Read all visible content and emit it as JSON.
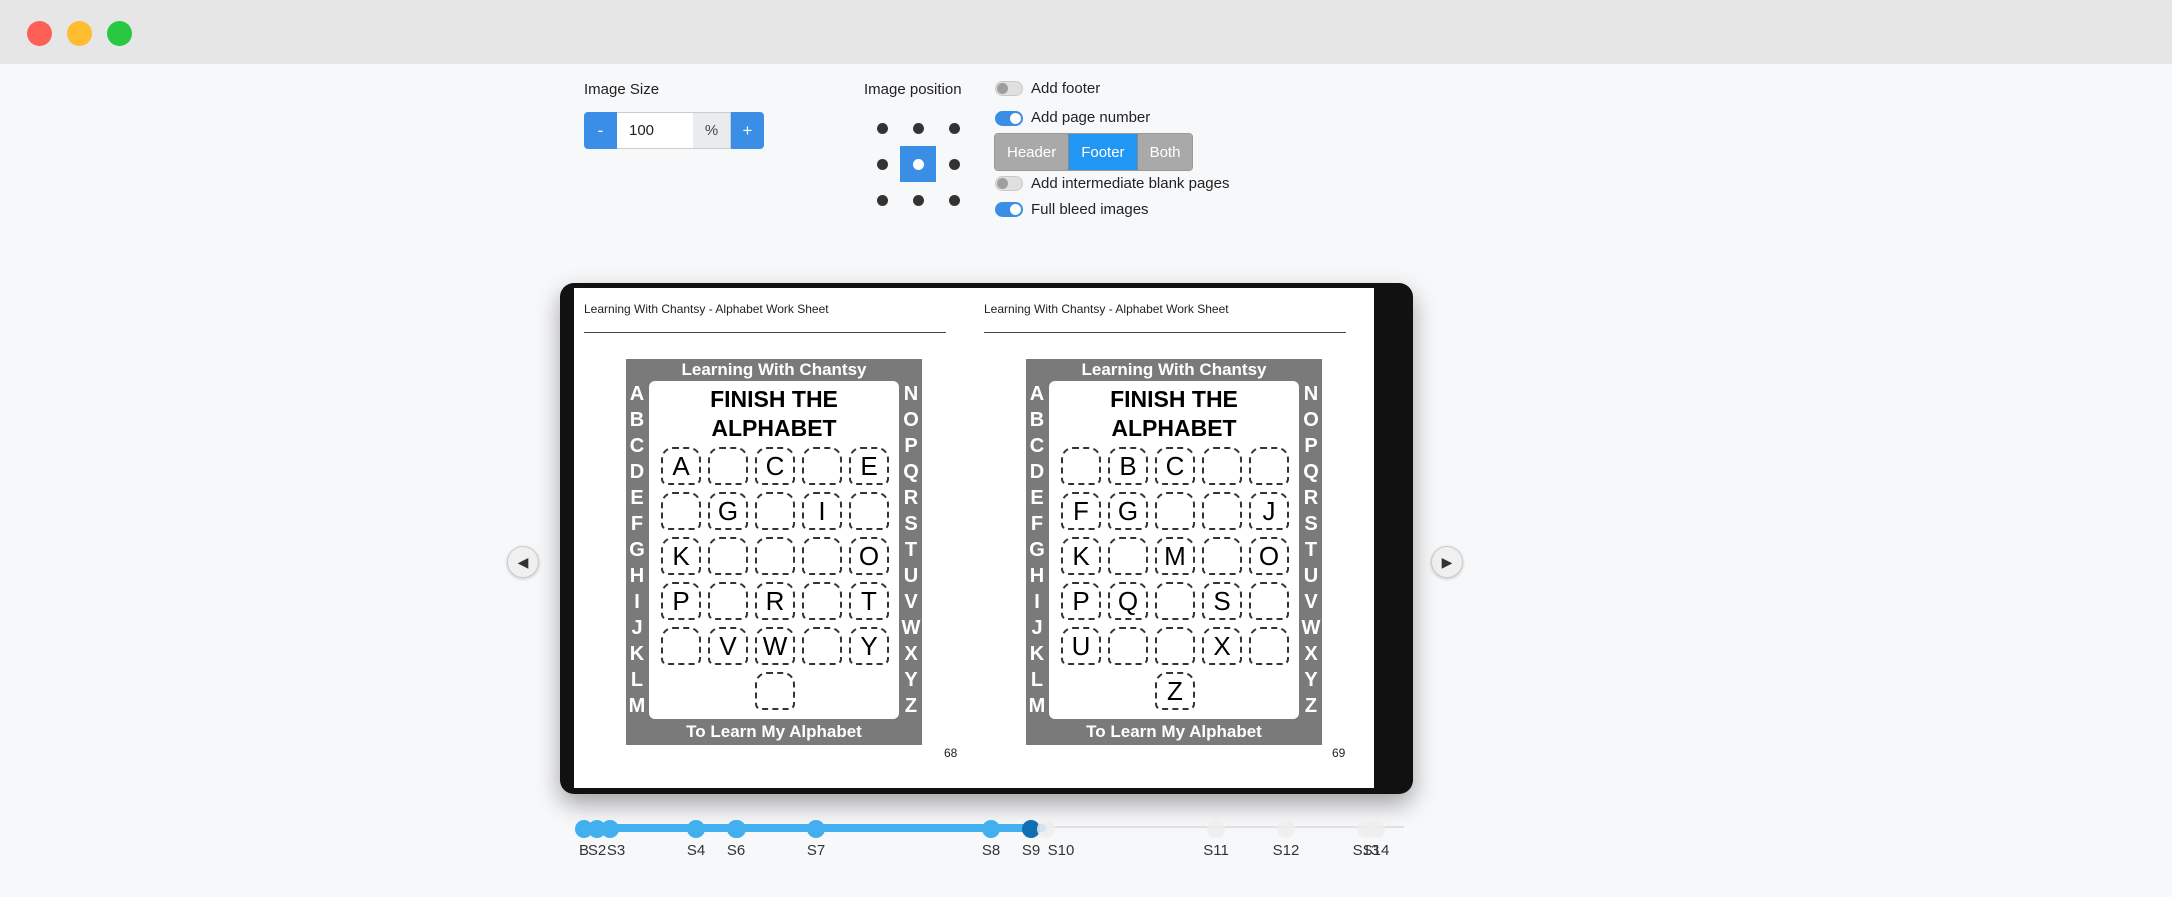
{
  "window": {
    "controls": [
      "close",
      "minimize",
      "maximize"
    ]
  },
  "image_size": {
    "label": "Image Size",
    "minus": "-",
    "value": "100",
    "unit": "%",
    "plus": "+"
  },
  "image_position": {
    "label": "Image position",
    "selected": "center"
  },
  "options": {
    "add_footer": {
      "label": "Add footer",
      "on": false
    },
    "add_page_number": {
      "label": "Add page number",
      "on": true
    },
    "page_number_position": {
      "options": [
        "Header",
        "Footer",
        "Both"
      ],
      "selected": "Footer"
    },
    "intermediate_blank": {
      "label": "Add intermediate blank pages",
      "on": false
    },
    "full_bleed": {
      "label": "Full bleed images",
      "on": true
    }
  },
  "book": {
    "left_page": {
      "header": "Learning With Chantsy - Alphabet Work Sheet",
      "number": "68",
      "worksheet": {
        "banner_top": "Learning With Chantsy",
        "title_line1": "FINISH THE",
        "title_line2": "ALPHABET",
        "banner_bottom": "To Learn My Alphabet",
        "left_column": [
          "A",
          "B",
          "C",
          "D",
          "E",
          "F",
          "G",
          "H",
          "I",
          "J",
          "K",
          "L",
          "M"
        ],
        "right_column": [
          "N",
          "O",
          "P",
          "Q",
          "R",
          "S",
          "T",
          "U",
          "V",
          "W",
          "X",
          "Y",
          "Z"
        ],
        "rows": [
          [
            "A",
            "",
            "C",
            "",
            "E"
          ],
          [
            "",
            "G",
            "",
            "I",
            ""
          ],
          [
            "K",
            "",
            "",
            "",
            "O"
          ],
          [
            "P",
            "",
            "R",
            "",
            "T"
          ],
          [
            "",
            "V",
            "W",
            "",
            "Y"
          ],
          [
            ""
          ]
        ]
      }
    },
    "right_page": {
      "header": "Learning With Chantsy - Alphabet Work Sheet",
      "number": "69",
      "worksheet": {
        "banner_top": "Learning With Chantsy",
        "title_line1": "FINISH THE",
        "title_line2": "ALPHABET",
        "banner_bottom": "To Learn My Alphabet",
        "left_column": [
          "A",
          "B",
          "C",
          "D",
          "E",
          "F",
          "G",
          "H",
          "I",
          "J",
          "K",
          "L",
          "M"
        ],
        "right_column": [
          "N",
          "O",
          "P",
          "Q",
          "R",
          "S",
          "T",
          "U",
          "V",
          "W",
          "X",
          "Y",
          "Z"
        ],
        "rows": [
          [
            "",
            "B",
            "C",
            "",
            ""
          ],
          [
            "F",
            "G",
            "",
            "",
            "J"
          ],
          [
            "K",
            "",
            "M",
            "",
            "O"
          ],
          [
            "P",
            "Q",
            "",
            "S",
            ""
          ],
          [
            "U",
            "",
            "",
            "X",
            ""
          ],
          [
            "Z"
          ]
        ]
      }
    }
  },
  "navigation": {
    "prev_icon": "chevron-left-icon",
    "next_icon": "chevron-right-icon"
  },
  "spread_slider": {
    "current": "S9",
    "nodes": [
      "B",
      "S2",
      "S3",
      "S4",
      "S5",
      "S6",
      "S7",
      "S8",
      "S9",
      "S10",
      "S11",
      "S12",
      "S13",
      "S14"
    ],
    "labels": [
      {
        "text": "B",
        "node": "B"
      },
      {
        "text": "S2",
        "node": "S2"
      },
      {
        "text": "S3",
        "node": "S3"
      },
      {
        "text": "S4",
        "node": "S4"
      },
      {
        "text": "S6",
        "node": "S6"
      },
      {
        "text": "S7",
        "node": "S7"
      },
      {
        "text": "S8",
        "node": "S8"
      },
      {
        "text": "S9",
        "node": "S9"
      },
      {
        "text": "S10",
        "node": "S10"
      },
      {
        "text": "S11",
        "node": "S11"
      },
      {
        "text": "S12",
        "node": "S12"
      },
      {
        "text": "S13",
        "node": "S13"
      },
      {
        "text": "S14",
        "node": "S14"
      }
    ]
  },
  "colors": {
    "accent": "#3a8ee6",
    "segment_active": "#2196f3",
    "slider_fill": "#42b0ee"
  }
}
